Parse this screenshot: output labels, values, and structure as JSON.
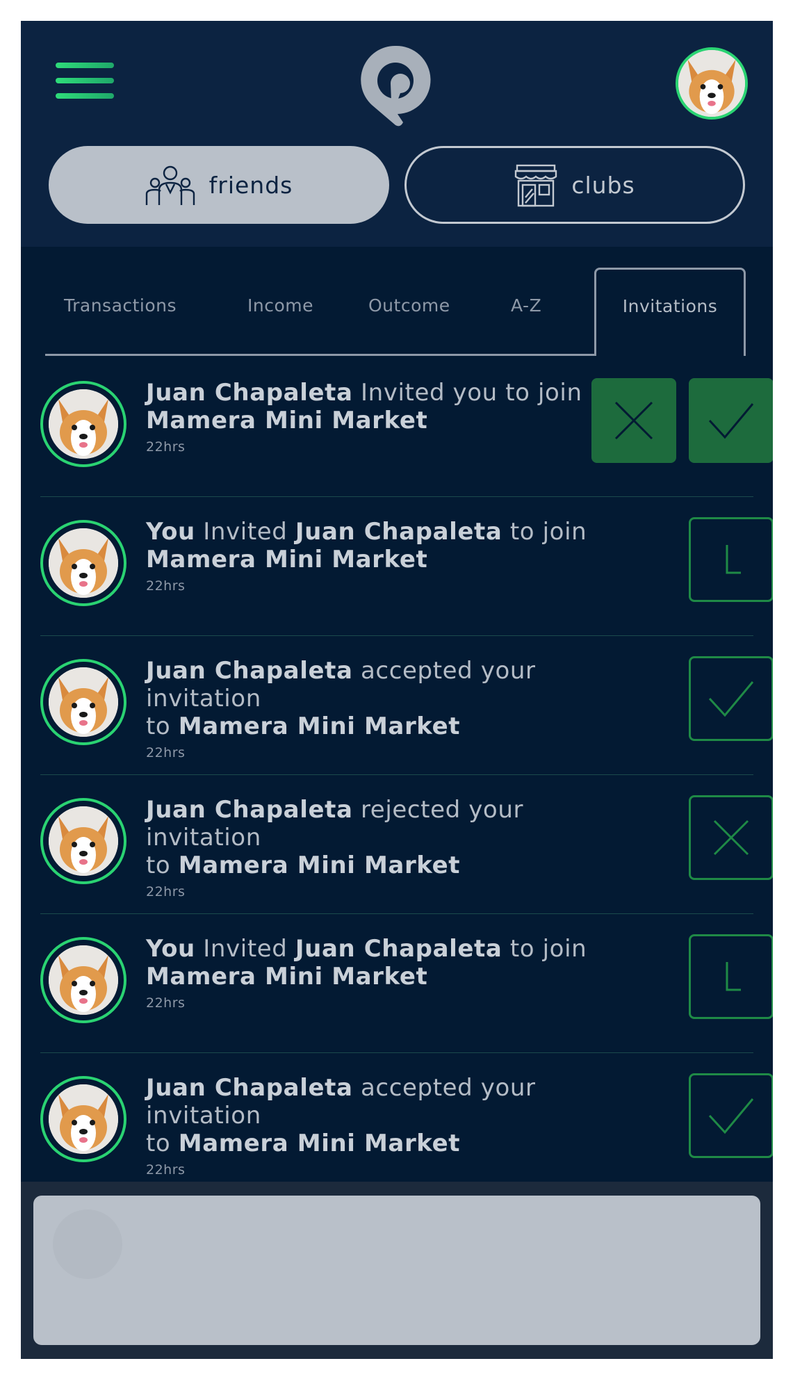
{
  "header": {
    "tabs": [
      {
        "label": "friends",
        "icon": "people-icon",
        "active": true
      },
      {
        "label": "clubs",
        "icon": "store-icon",
        "active": false
      }
    ]
  },
  "subtabs": [
    {
      "label": "Transactions"
    },
    {
      "label": "Income"
    },
    {
      "label": "Outcome"
    },
    {
      "label": "A-Z"
    },
    {
      "label": "Invitations",
      "active": true
    }
  ],
  "notifications": [
    {
      "actor": "Juan Chapaleta",
      "verb": "Invited you to join",
      "target_prefix": "",
      "target": "Mamera Mini Market",
      "time": "22hrs",
      "actions": [
        "reject",
        "accept"
      ]
    },
    {
      "actor": "You",
      "verb": "Invited",
      "object": "Juan Chapaleta",
      "verb2": "to join",
      "target": "Mamera Mini Market",
      "time": "22hrs",
      "status": "pending"
    },
    {
      "actor": "Juan Chapaleta",
      "verb": "accepted your invitation",
      "target_prefix": "to",
      "target": "Mamera Mini Market",
      "time": "22hrs",
      "status": "accepted"
    },
    {
      "actor": "Juan Chapaleta",
      "verb": "rejected your invitation",
      "target_prefix": "to",
      "target": "Mamera Mini Market",
      "time": "22hrs",
      "status": "rejected"
    },
    {
      "actor": "You",
      "verb": "Invited",
      "object": "Juan Chapaleta",
      "verb2": "to join",
      "target": "Mamera Mini Market",
      "time": "22hrs",
      "status": "pending"
    },
    {
      "actor": "Juan Chapaleta",
      "verb": "accepted your invitation",
      "target_prefix": "to",
      "target": "Mamera Mini Market",
      "time": "22hrs",
      "status": "accepted"
    }
  ],
  "colors": {
    "background": "#031a33",
    "header": "#0c2341",
    "accent_green": "#2ad372",
    "action_green": "#1d6b3d",
    "text": "#b4bcc6"
  },
  "icons": {
    "menu": "hamburger-menu-icon",
    "logo": "location-pin-logo",
    "accept": "checkmark-icon",
    "reject": "x-icon",
    "pending": "clock-icon"
  }
}
